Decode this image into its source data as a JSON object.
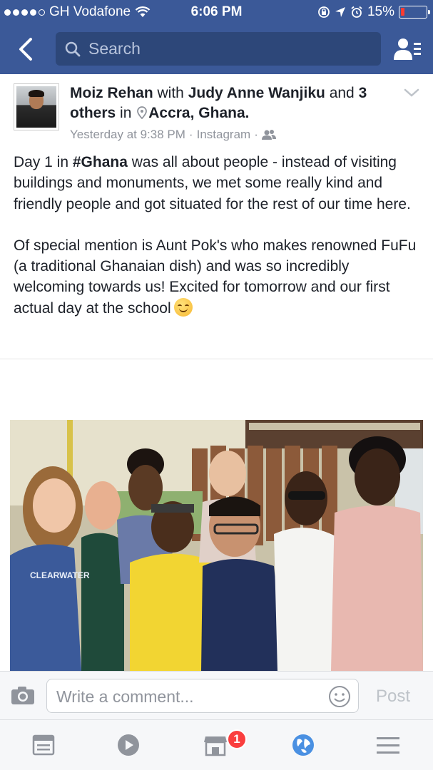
{
  "status_bar": {
    "carrier": "GH Vodafone",
    "time": "6:06 PM",
    "battery": "15%",
    "battery_level": 0.15
  },
  "nav": {
    "search_placeholder": "Search"
  },
  "post": {
    "author": "Moiz Rehan",
    "with_word": "with",
    "tagged": "Judy Anne Wanjiku",
    "and_word": "and",
    "others": "3 others",
    "in_word": "in",
    "location": "Accra, Ghana.",
    "timestamp": "Yesterday at 9:38 PM",
    "source": "Instagram",
    "separator": "·",
    "paragraph1_pre": "Day 1 in ",
    "hashtag": "#Ghana",
    "paragraph1_post": " was all about people - instead of visiting buildings and monuments, we met some really kind and friendly people and got situated for the rest of our time here.",
    "paragraph2": "Of special mention is Aunt Pok's who makes renowned FuFu (a traditional Ghanaian dish) and was so incredibly welcoming towards us! Excited for tomorrow and our first actual day at the school",
    "photo_shirt_text": "CLEARWATER"
  },
  "comment_bar": {
    "placeholder": "Write a comment...",
    "post_label": "Post"
  },
  "tab_bar": {
    "items": [
      "news-feed",
      "video",
      "marketplace",
      "notifications",
      "menu"
    ],
    "marketplace_badge": "1"
  },
  "colors": {
    "brand": "#3b5998",
    "badge": "#fa3e3e",
    "notifications_active": "#4a90e2"
  }
}
